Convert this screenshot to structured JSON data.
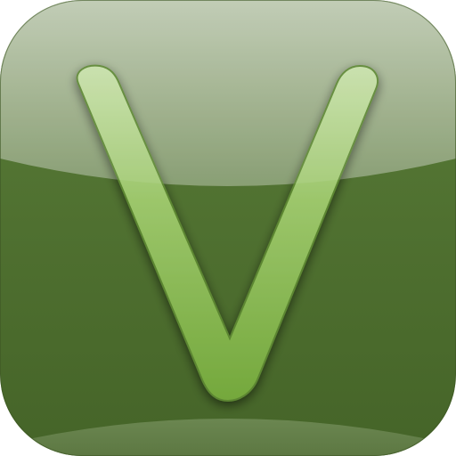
{
  "app_icon": {
    "glyph": "V",
    "icon_name": "letter-v-app-icon",
    "colors": {
      "background_dark": "#4a6b2c",
      "background_mid": "#557836",
      "gloss_top": "#c9d3bf",
      "gloss_bottom": "#8aa174",
      "glyph_light": "#bcd89e",
      "glyph_main": "#7fae45",
      "glyph_outline": "#5f8a33",
      "shadow": "#2c3f1a"
    }
  }
}
